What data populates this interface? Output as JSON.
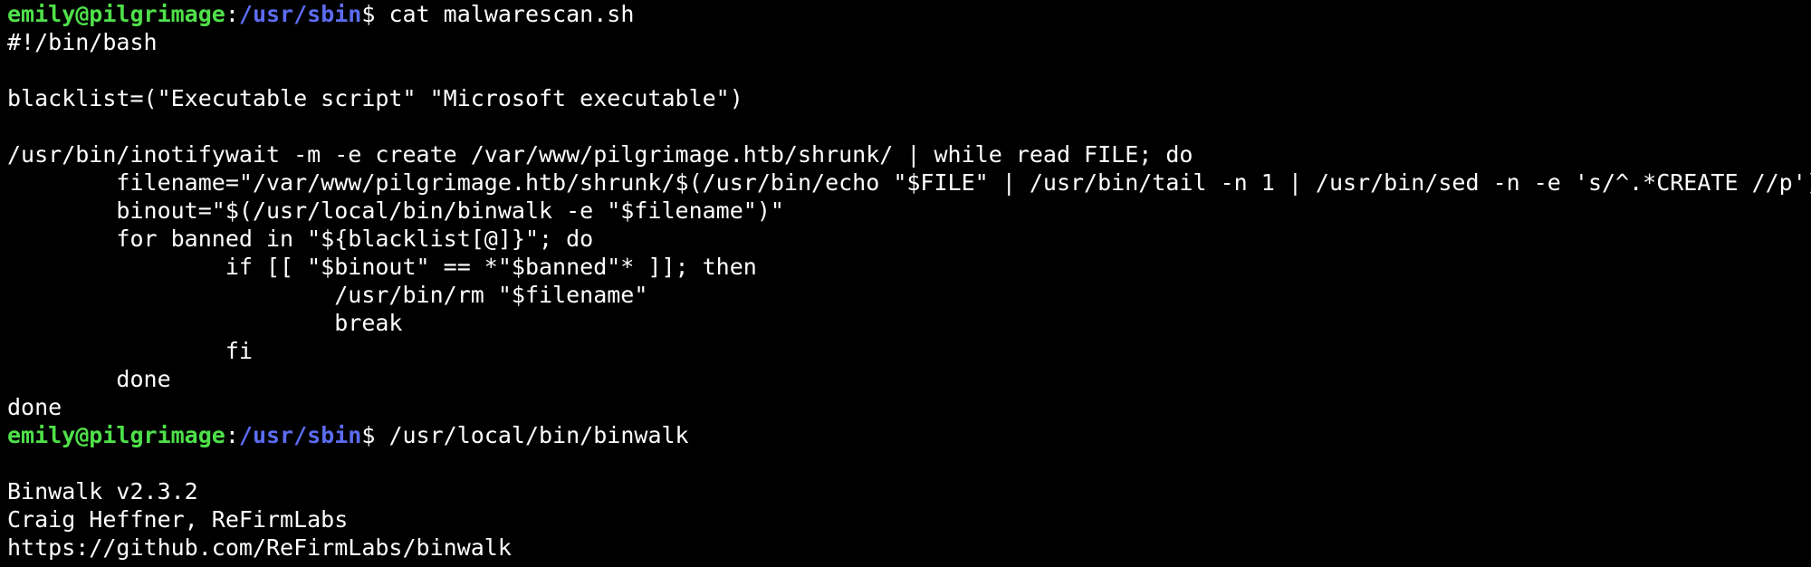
{
  "colors": {
    "background": "#000000",
    "foreground": "#ffffff",
    "prompt_user": "#4fe04a",
    "prompt_path": "#5c6cf2"
  },
  "prompt1": {
    "user_host": "emily@pilgrimage",
    "sep": ":",
    "path": "/usr/sbin",
    "dollar": "$ ",
    "command": "cat malwarescan.sh"
  },
  "script_lines": [
    "#!/bin/bash",
    "",
    "blacklist=(\"Executable script\" \"Microsoft executable\")",
    "",
    "/usr/bin/inotifywait -m -e create /var/www/pilgrimage.htb/shrunk/ | while read FILE; do",
    "        filename=\"/var/www/pilgrimage.htb/shrunk/$(/usr/bin/echo \"$FILE\" | /usr/bin/tail -n 1 | /usr/bin/sed -n -e 's/^.*CREATE //p')\"",
    "        binout=\"$(/usr/local/bin/binwalk -e \"$filename\")\"",
    "        for banned in \"${blacklist[@]}\"; do",
    "                if [[ \"$binout\" == *\"$banned\"* ]]; then",
    "                        /usr/bin/rm \"$filename\"",
    "                        break",
    "                fi",
    "        done",
    "done"
  ],
  "prompt2": {
    "user_host": "emily@pilgrimage",
    "sep": ":",
    "path": "/usr/sbin",
    "dollar": "$ ",
    "command": "/usr/local/bin/binwalk"
  },
  "binwalk_output": [
    "",
    "Binwalk v2.3.2",
    "Craig Heffner, ReFirmLabs",
    "https://github.com/ReFirmLabs/binwalk"
  ]
}
